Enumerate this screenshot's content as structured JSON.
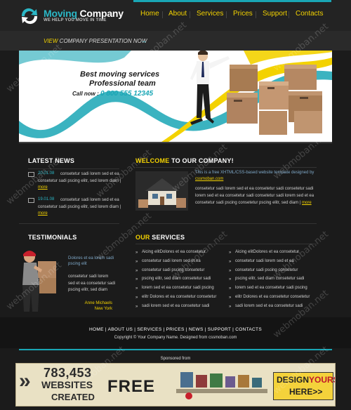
{
  "brand": {
    "title_part1": "Moving",
    "title_part2": " Company",
    "tagline": "WE HELP YOU MOVE IN TIME",
    "accent": "#2bb7c6",
    "highlight": "#f3d200"
  },
  "nav": {
    "items": [
      "Home",
      "About",
      "Services",
      "Prices",
      "Support",
      "Contacts"
    ]
  },
  "presentation": {
    "view_label": "VIEW",
    "view_text": " COMPANY PRESENTATION NOW",
    "arrow": "→"
  },
  "hero": {
    "title": "Best moving services",
    "subtitle": "Professional team",
    "call_label": "Call now : ",
    "phone": "0 800 555 12345"
  },
  "news": {
    "title": "LATEST NEWS",
    "items": [
      {
        "date": "20.01.08",
        "text": "consetetur sadi lorem sed et ea consetetur sadi pscing elitr, sed lorem diam",
        "more": "more"
      },
      {
        "date": "19.01.08",
        "text": "consetetur sadi lorem sed et ea consetetur sadi pscing elitr, sed lorem diam",
        "more": "more"
      }
    ]
  },
  "welcome": {
    "title_yellow": "WELCOME",
    "title_white": " TO OUR COMPANY!",
    "lead_text": "This is a free XHTML/CSS-based website template designed by",
    "lead_link": "cssmoban.com",
    "body": "consetetur sadi lorem sed et ea consetetur sadi consetetur sadi lorem sed et ea consetetur sadi consetetur sadi lorem sed et ea consetetur sadi pscing consetetur pscing elitr, sed diam",
    "more": "more"
  },
  "services": {
    "title_yellow": "OUR",
    "title_white": " SERVICES",
    "col1": [
      "Aicing elitDolores et ea consetetur",
      "consetetur sadi lorem sed et ea",
      "consetetur sadi pscing consetetur",
      "pscing elitr, sed diam consetetur sadi",
      "lorem sed et ea consetetur sadi pscing",
      "elitr Dolores et ea consetetur consetetur",
      "sadi lorem sed et ea consetetur sadi"
    ],
    "col2": [
      "Aicing elitDolores et ea consetetur",
      "consetetur sadi lorem sed et ea",
      "consetetur sadi pscing consetetur",
      "pscing elitr, sed diam consetetur sadi",
      "lorem sed et ea consetetur sadi pscing",
      "elitr Dolores et ea consetetur consetetur",
      "sadi lorem sed et ea consetetur sadi"
    ]
  },
  "testimonials": {
    "title": "TESTIMONIALS",
    "lead": "Dolores et ea lorem sadi pscing elit",
    "body": "consetetur sadi lorem sed et ea consetetur sadi pscing elitr, sed diam",
    "name": "Anne Michaels",
    "city": "New York"
  },
  "footer": {
    "links": [
      "HOME",
      "ABOUT US",
      "SERVICES",
      "PRICES",
      "NEWS",
      "SUPPORT",
      "CONTACTS"
    ],
    "copyright": "Copyright © Your Company Name. Designed from  cssmoban.com",
    "sponsored": "Sponsored from"
  },
  "ad": {
    "number": "783,453",
    "line1": "WEBSITES",
    "line2": "CREATED",
    "free": "FREE",
    "design_a": "DESIGN",
    "design_b": "YOURS!",
    "here": "HERE>>"
  },
  "watermark": "webmoban.net"
}
